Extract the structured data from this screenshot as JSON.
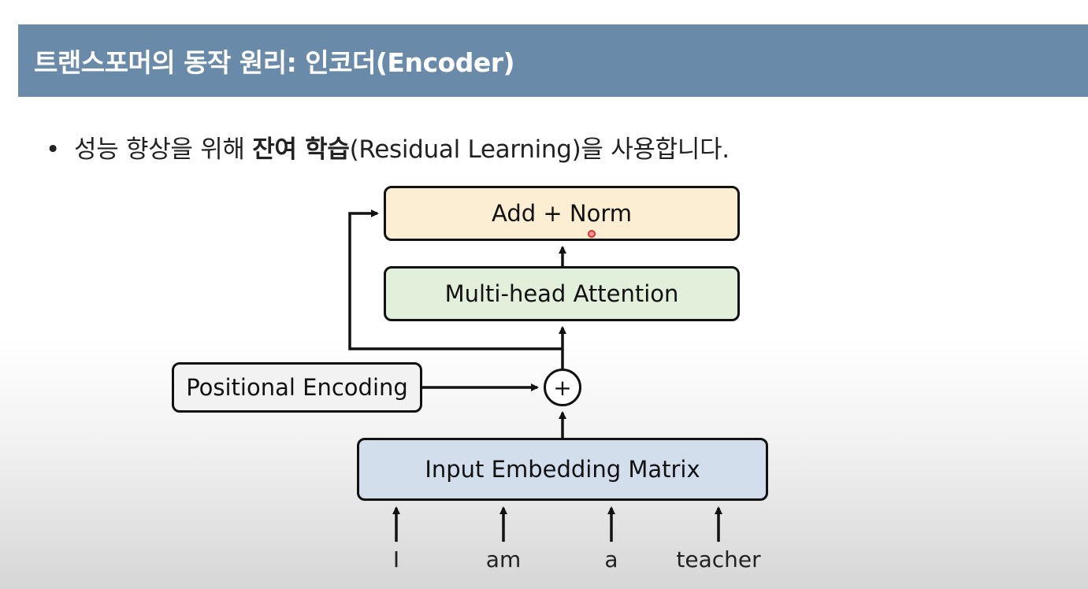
{
  "title": "트랜스포머의 동작 원리: 인코더(Encoder)",
  "bullet": {
    "symbol": "•",
    "text_before": "성능 향상을 위해 ",
    "text_bold": "잔여 학습",
    "text_after": "(Residual Learning)을 사용합니다."
  },
  "diagram": {
    "add_norm": "Add + Norm",
    "multi_head_attention": "Multi-head Attention",
    "positional_encoding": "Positional Encoding",
    "plus_symbol": "+",
    "input_embedding_matrix": "Input Embedding Matrix",
    "input_words": [
      "I",
      "am",
      "a",
      "teacher"
    ]
  },
  "colors": {
    "title_bar": "#6a8aaa",
    "add_norm_fill": "#fbeed2",
    "mha_fill": "#e2efda",
    "pe_fill": "#f2f2f2",
    "iem_fill": "#d2deec"
  }
}
